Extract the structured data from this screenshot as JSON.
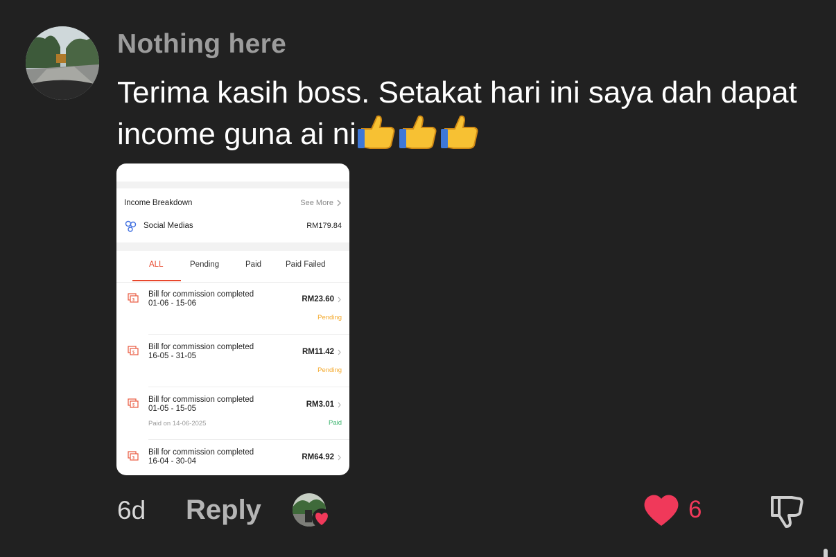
{
  "comment": {
    "username": "Nothing here",
    "text": "Terima kasih boss. Setakat hari ini saya dah dapat income guna ai ni",
    "emoji": [
      "thumbs-up",
      "thumbs-up",
      "thumbs-up"
    ]
  },
  "attachment": {
    "income_breakdown_label": "Income Breakdown",
    "see_more_label": "See More",
    "source_label": "Social Medias",
    "source_amount": "RM179.84",
    "tabs": [
      "ALL",
      "Pending",
      "Paid",
      "Paid Failed"
    ],
    "active_tab": "ALL",
    "items": [
      {
        "title": "Bill for commission completed",
        "date": "01-06 - 15-06",
        "amount": "RM23.60",
        "status": "Pending",
        "paid_on": ""
      },
      {
        "title": "Bill for commission completed",
        "date": "16-05 - 31-05",
        "amount": "RM11.42",
        "status": "Pending",
        "paid_on": ""
      },
      {
        "title": "Bill for commission completed",
        "date": "01-05 - 15-05",
        "amount": "RM3.01",
        "status": "Paid",
        "paid_on": "Paid on 14-06-2025"
      },
      {
        "title": "Bill for commission completed",
        "date": "16-04 - 30-04",
        "amount": "RM64.92",
        "status": "",
        "paid_on": ""
      }
    ],
    "colors": {
      "active": "#e8472c",
      "pending": "#f4a92b",
      "paid": "#3cb46e"
    }
  },
  "footer": {
    "age": "6d",
    "reply_label": "Reply",
    "like_count": "6",
    "like_color": "#f0395a"
  }
}
